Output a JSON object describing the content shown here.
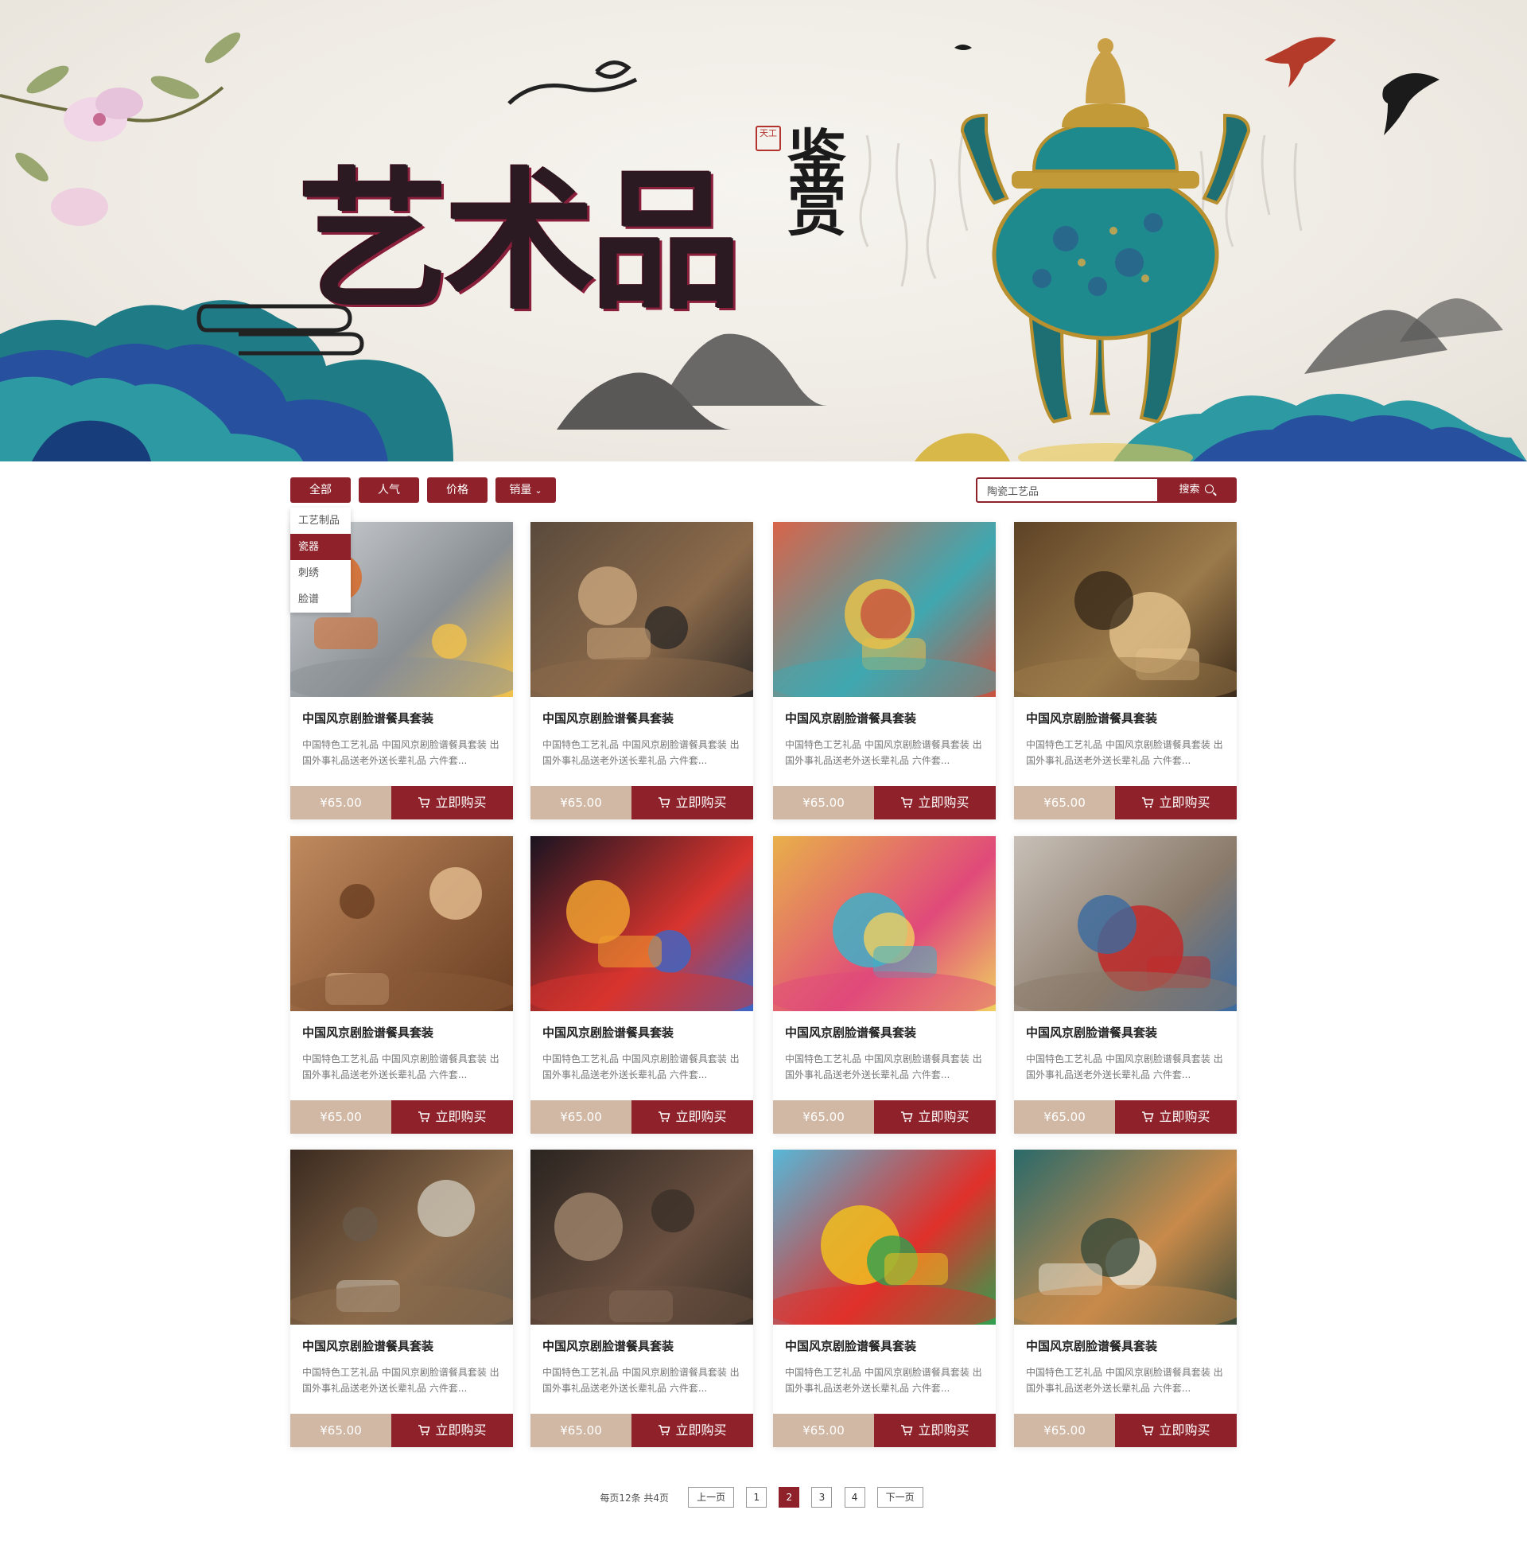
{
  "banner": {
    "title": "艺术品",
    "subtitle": "鉴赏",
    "seal": "天工"
  },
  "filters": {
    "all": "全部",
    "popular": "人气",
    "price": "价格",
    "sales": "销量"
  },
  "dropdown": {
    "items": [
      "工艺制品",
      "瓷器",
      "刺绣",
      "脸谱"
    ],
    "active_index": 1
  },
  "search": {
    "value": "陶瓷工艺品",
    "button_label": "搜索"
  },
  "products": [
    {
      "title": "中国风京剧脸谱餐具套装",
      "desc": "中国特色工艺礼品 中国风京剧脸谱餐具套装 出国外事礼品送老外送长辈礼品 六件套...",
      "price": "¥65.00",
      "buy": "立即购买"
    },
    {
      "title": "中国风京剧脸谱餐具套装",
      "desc": "中国特色工艺礼品 中国风京剧脸谱餐具套装 出国外事礼品送老外送长辈礼品 六件套...",
      "price": "¥65.00",
      "buy": "立即购买"
    },
    {
      "title": "中国风京剧脸谱餐具套装",
      "desc": "中国特色工艺礼品 中国风京剧脸谱餐具套装 出国外事礼品送老外送长辈礼品 六件套...",
      "price": "¥65.00",
      "buy": "立即购买"
    },
    {
      "title": "中国风京剧脸谱餐具套装",
      "desc": "中国特色工艺礼品 中国风京剧脸谱餐具套装 出国外事礼品送老外送长辈礼品 六件套...",
      "price": "¥65.00",
      "buy": "立即购买"
    },
    {
      "title": "中国风京剧脸谱餐具套装",
      "desc": "中国特色工艺礼品 中国风京剧脸谱餐具套装 出国外事礼品送老外送长辈礼品 六件套...",
      "price": "¥65.00",
      "buy": "立即购买"
    },
    {
      "title": "中国风京剧脸谱餐具套装",
      "desc": "中国特色工艺礼品 中国风京剧脸谱餐具套装 出国外事礼品送老外送长辈礼品 六件套...",
      "price": "¥65.00",
      "buy": "立即购买"
    },
    {
      "title": "中国风京剧脸谱餐具套装",
      "desc": "中国特色工艺礼品 中国风京剧脸谱餐具套装 出国外事礼品送老外送长辈礼品 六件套...",
      "price": "¥65.00",
      "buy": "立即购买"
    },
    {
      "title": "中国风京剧脸谱餐具套装",
      "desc": "中国特色工艺礼品 中国风京剧脸谱餐具套装 出国外事礼品送老外送长辈礼品 六件套...",
      "price": "¥65.00",
      "buy": "立即购买"
    },
    {
      "title": "中国风京剧脸谱餐具套装",
      "desc": "中国特色工艺礼品 中国风京剧脸谱餐具套装 出国外事礼品送老外送长辈礼品 六件套...",
      "price": "¥65.00",
      "buy": "立即购买"
    },
    {
      "title": "中国风京剧脸谱餐具套装",
      "desc": "中国特色工艺礼品 中国风京剧脸谱餐具套装 出国外事礼品送老外送长辈礼品 六件套...",
      "price": "¥65.00",
      "buy": "立即购买"
    },
    {
      "title": "中国风京剧脸谱餐具套装",
      "desc": "中国特色工艺礼品 中国风京剧脸谱餐具套装 出国外事礼品送老外送长辈礼品 六件套...",
      "price": "¥65.00",
      "buy": "立即购买"
    },
    {
      "title": "中国风京剧脸谱餐具套装",
      "desc": "中国特色工艺礼品 中国风京剧脸谱餐具套装 出国外事礼品送老外送长辈礼品 六件套...",
      "price": "¥65.00",
      "buy": "立即购买"
    }
  ],
  "pagination": {
    "info": "每页12条 共4页",
    "prev": "上一页",
    "next": "下一页",
    "pages": [
      "1",
      "2",
      "3",
      "4"
    ],
    "current": "2"
  },
  "colors": {
    "accent": "#8e2129",
    "price_bg": "#d1b8a4"
  }
}
